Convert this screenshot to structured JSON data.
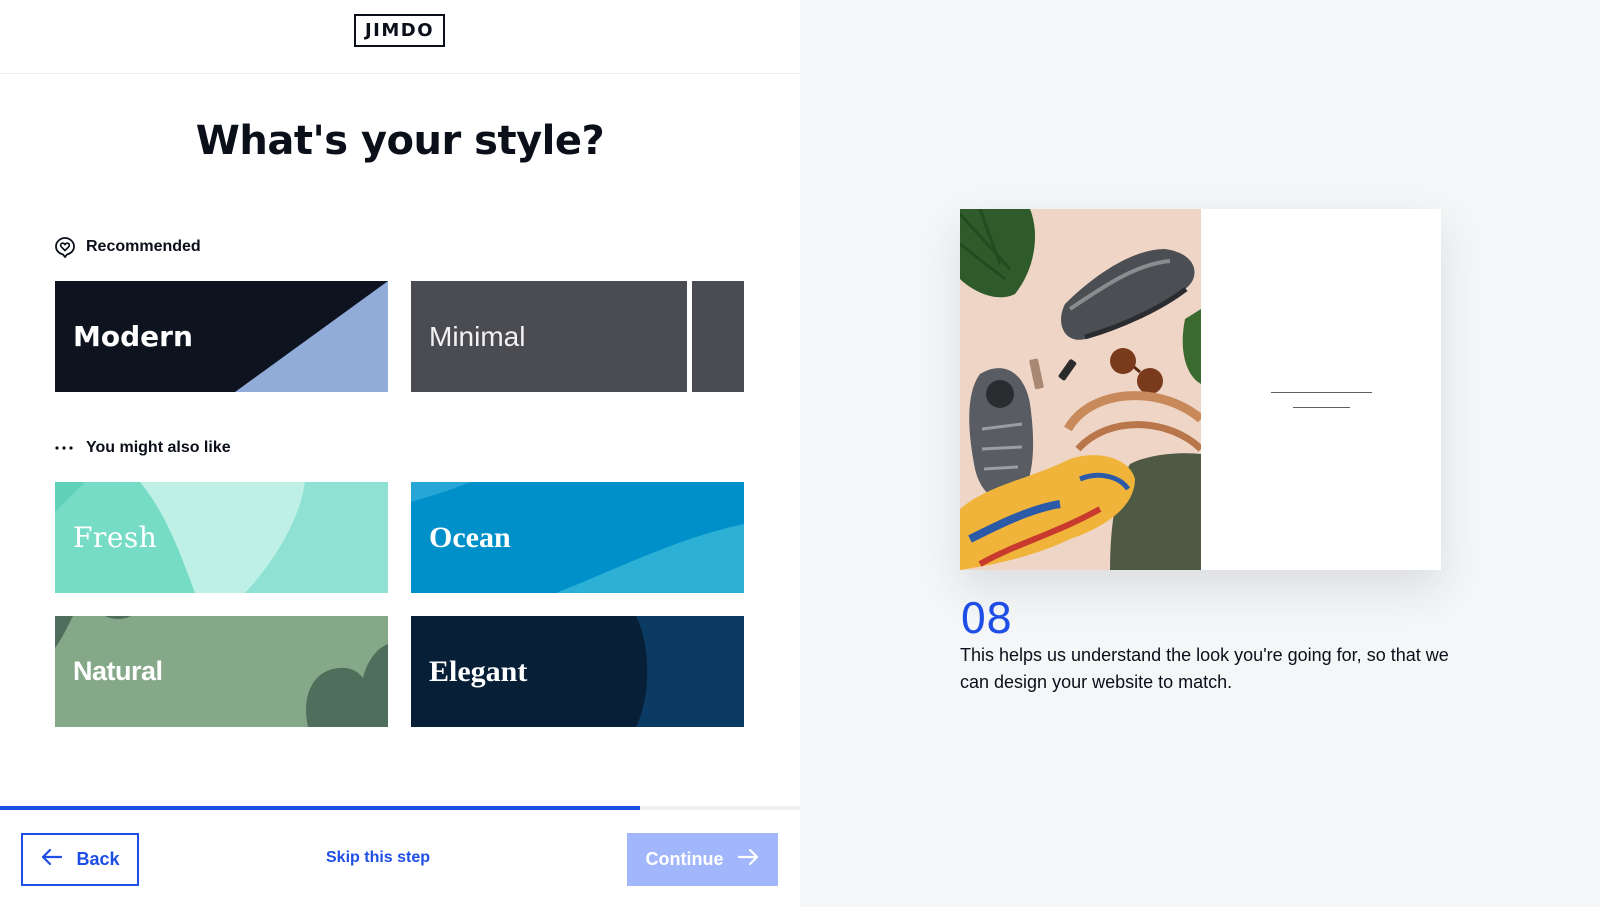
{
  "brand": {
    "logo_text": "JIMDO"
  },
  "title": "What's your style?",
  "sections": {
    "recommended": {
      "label": "Recommended",
      "icon": "heart-badge-icon"
    },
    "also_like": {
      "label": "You might also like",
      "icon": "ellipsis-icon"
    }
  },
  "styles": {
    "modern": {
      "label": "Modern"
    },
    "minimal": {
      "label": "Minimal"
    },
    "fresh": {
      "label": "Fresh"
    },
    "ocean": {
      "label": "Ocean"
    },
    "natural": {
      "label": "Natural"
    },
    "elegant": {
      "label": "Elegant"
    }
  },
  "progress": {
    "fraction": 0.8
  },
  "footer": {
    "back_label": "Back",
    "skip_label": "Skip this step",
    "continue_label": "Continue",
    "continue_enabled": false
  },
  "info": {
    "step_number": "08",
    "description": "This helps us understand the look you're going for, so that we can design your website to match."
  },
  "colors": {
    "accent": "#1f4ee6",
    "continue_disabled": "#a1b6fb",
    "right_panel_bg": "#f4f6f7"
  }
}
